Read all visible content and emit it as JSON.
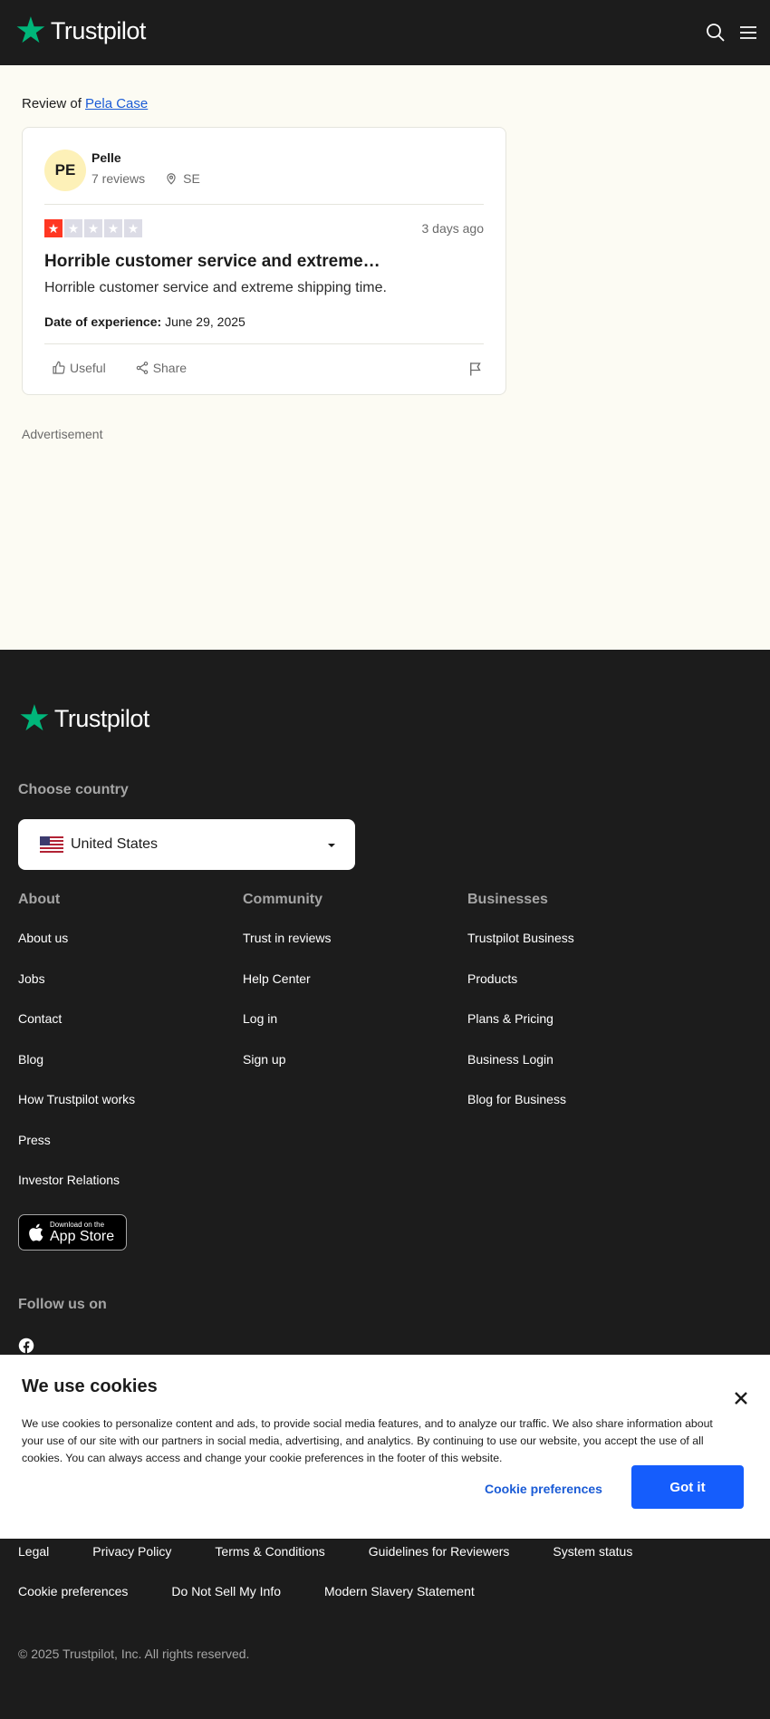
{
  "header": {
    "brand": "Trustpilot"
  },
  "review": {
    "review_of_label": "Review of",
    "business": "Pela Case",
    "avatar_initials": "PE",
    "reviewer": "Pelle",
    "review_count": "7 reviews",
    "country": "SE",
    "rating": 1,
    "max_rating": 5,
    "date": "3 days ago",
    "title": "Horrible customer service and extreme…",
    "body": "Horrible customer service and extreme shipping time.",
    "experience_label": "Date of experience:",
    "experience_date": "June 29, 2025",
    "useful_label": "Useful",
    "share_label": "Share"
  },
  "advertisement_label": "Advertisement",
  "footer": {
    "brand": "Trustpilot",
    "choose_country": "Choose country",
    "country": "United States",
    "columns": [
      {
        "title": "About",
        "links": [
          "About us",
          "Jobs",
          "Contact",
          "Blog",
          "How Trustpilot works",
          "Press",
          "Investor Relations"
        ]
      },
      {
        "title": "Community",
        "links": [
          "Trust in reviews",
          "Help Center",
          "Log in",
          "Sign up"
        ]
      },
      {
        "title": "Businesses",
        "links": [
          "Trustpilot Business",
          "Products",
          "Plans & Pricing",
          "Business Login",
          "Blog for Business"
        ]
      }
    ],
    "appstore_line1": "Download on the",
    "appstore_line2": "App Store",
    "follow": "Follow us on",
    "legal_row1": [
      "Legal",
      "Privacy Policy",
      "Terms & Conditions",
      "Guidelines for Reviewers",
      "System status"
    ],
    "legal_row2": [
      "Cookie preferences",
      "Do Not Sell My Info",
      "Modern Slavery Statement"
    ],
    "copyright": "© 2025 Trustpilot, Inc. All rights reserved."
  },
  "cookie": {
    "title": "We use cookies",
    "text": "We use cookies to personalize content and ads, to provide social media features, and to analyze our traffic. We also share information about your use of our site with our partners in social media, advertising, and analytics. By continuing to use our website, you accept the use of all cookies. You can always access and change your cookie preferences in the footer of this website.",
    "preferences_label": "Cookie preferences",
    "accept_label": "Got it"
  },
  "colors": {
    "brand_green": "#00b67a",
    "star_red": "#ff3722",
    "link_blue": "#1a5bd6",
    "button_blue": "#155dfc"
  }
}
